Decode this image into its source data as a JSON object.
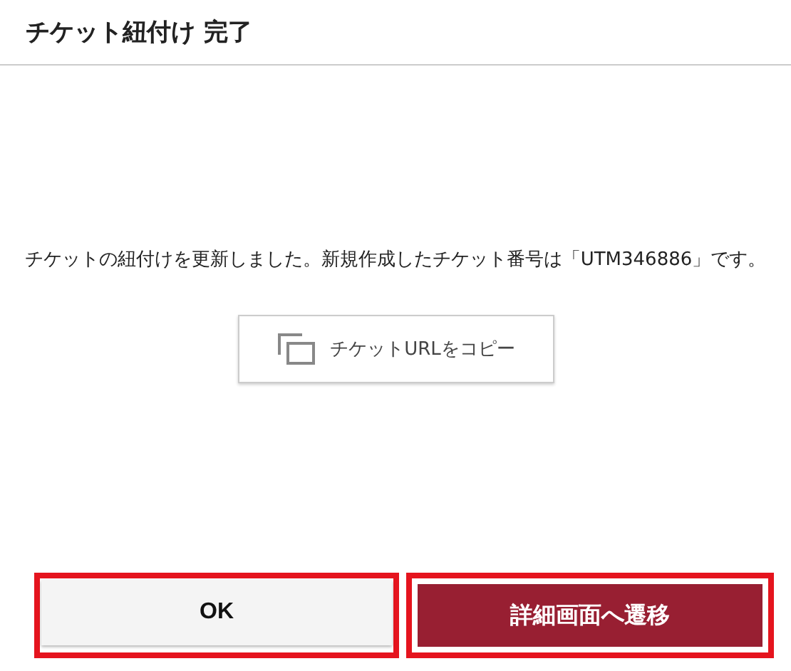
{
  "dialog": {
    "title": "チケット紐付け 完了"
  },
  "message": "チケットの紐付けを更新しました。新規作成したチケット番号は「UTM346886」です。",
  "copy_button": {
    "label": "チケットURLをコピー"
  },
  "buttons": [
    {
      "label": "OK",
      "kind": "secondary",
      "highlighted": true
    },
    {
      "label": "詳細画面へ遷移",
      "kind": "primary",
      "highlighted": true
    }
  ]
}
